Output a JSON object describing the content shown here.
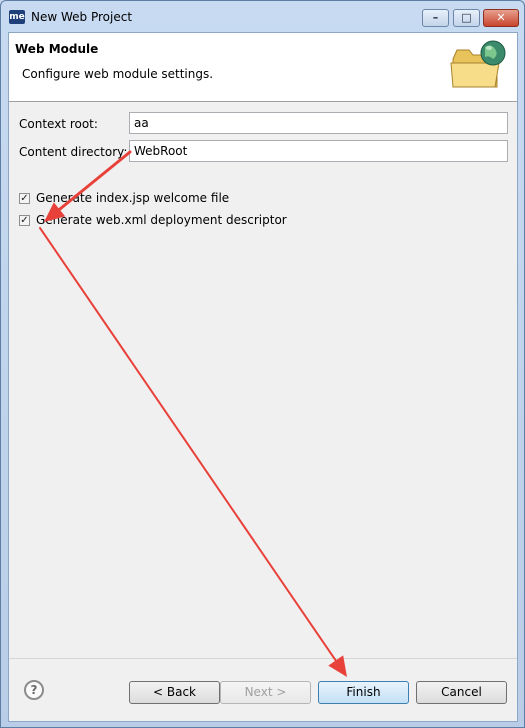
{
  "window": {
    "title": "New Web Project",
    "app_icon_text": "me",
    "controls": {
      "minimize": "–",
      "maximize": "□",
      "close": "✕"
    }
  },
  "banner": {
    "title": "Web Module",
    "description": "Configure web module settings.",
    "icon": "folder-globe-icon"
  },
  "form": {
    "context_root": {
      "label": "Context root:",
      "value": "aa"
    },
    "content_directory": {
      "label": "Content directory:",
      "value": "WebRoot"
    }
  },
  "options": [
    {
      "label": "Generate index.jsp welcome file",
      "checked": true
    },
    {
      "label": "Generate web.xml deployment descriptor",
      "checked": true
    }
  ],
  "footer": {
    "help": "?",
    "back": "< Back",
    "next": "Next >",
    "finish": "Finish",
    "cancel": "Cancel"
  },
  "annotation_color": "#e8413a"
}
